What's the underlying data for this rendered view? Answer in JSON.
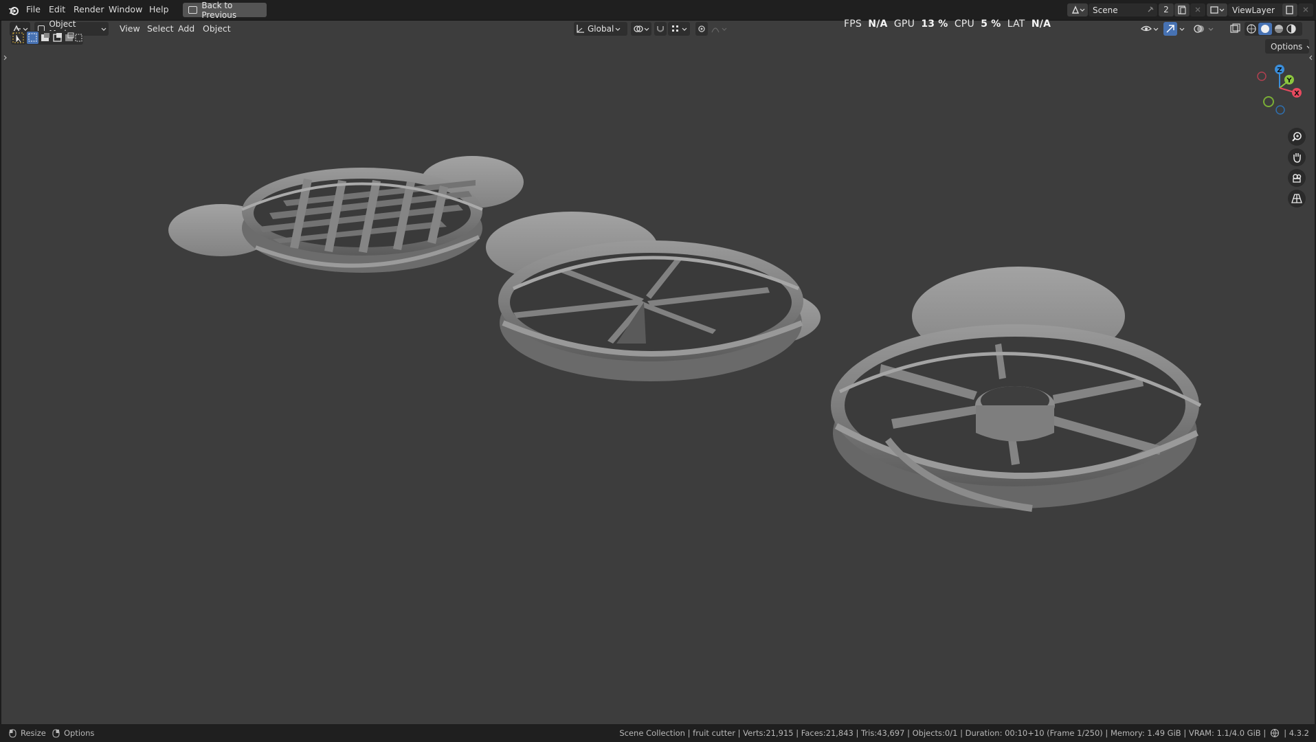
{
  "menu": {
    "file": "File",
    "edit": "Edit",
    "render": "Render",
    "window": "Window",
    "help": "Help",
    "back_button": "Back to Previous"
  },
  "topbar_right": {
    "scene_label": "Scene",
    "scene_count": "2",
    "view_layer_label": "ViewLayer"
  },
  "viewport_header": {
    "mode": "Object Mode",
    "view": "View",
    "select": "Select",
    "add": "Add",
    "object": "Object",
    "transform_orientation": "Global",
    "options": "Options"
  },
  "stats_overlay": {
    "fps_label": "FPS",
    "fps_value": "N/A",
    "gpu_label": "GPU",
    "gpu_value": "13 %",
    "cpu_label": "CPU",
    "cpu_value": "5 %",
    "lat_label": "LAT",
    "lat_value": "N/A"
  },
  "gizmo": {
    "z": "Z",
    "y": "Y",
    "x": "X"
  },
  "statusbar": {
    "resize": "Resize",
    "options": "Options",
    "info": "Scene Collection | fruit cutter | Verts:21,915 | Faces:21,843 | Tris:43,697 | Objects:0/1 | Duration: 00:10+10 (Frame 1/250) | Memory: 1.49 GiB | VRAM: 1.1/4.0 GiB |",
    "version": "4.3.2"
  },
  "colors": {
    "viewport_bg": "#3d3d3d",
    "accent_blue": "#4772b3",
    "axis_x": "#e84a5f",
    "axis_y": "#8cc63f",
    "axis_z": "#3a8edb"
  }
}
